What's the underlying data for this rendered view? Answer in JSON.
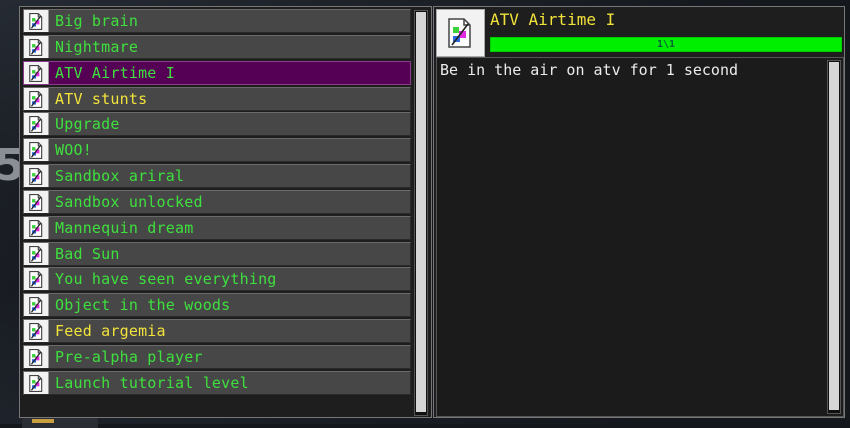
{
  "achievements": [
    {
      "label": "Big brain",
      "color": "#3ee03e",
      "selected": false
    },
    {
      "label": "Nightmare",
      "color": "#3ee03e",
      "selected": false
    },
    {
      "label": "ATV Airtime I",
      "color": "#3ee03e",
      "selected": true
    },
    {
      "label": "ATV stunts",
      "color": "#f2e33a",
      "selected": false
    },
    {
      "label": "Upgrade",
      "color": "#3ee03e",
      "selected": false
    },
    {
      "label": "WOO!",
      "color": "#3ee03e",
      "selected": false
    },
    {
      "label": "Sandbox ariral",
      "color": "#3ee03e",
      "selected": false
    },
    {
      "label": "Sandbox unlocked",
      "color": "#3ee03e",
      "selected": false
    },
    {
      "label": "Mannequin dream",
      "color": "#3ee03e",
      "selected": false
    },
    {
      "label": "Bad Sun",
      "color": "#3ee03e",
      "selected": false
    },
    {
      "label": "You have seen everything",
      "color": "#3ee03e",
      "selected": false
    },
    {
      "label": "Object in the woods",
      "color": "#3ee03e",
      "selected": false
    },
    {
      "label": "Feed argemia",
      "color": "#f2e33a",
      "selected": false
    },
    {
      "label": "Pre-alpha player",
      "color": "#3ee03e",
      "selected": false
    },
    {
      "label": "Launch tutorial level",
      "color": "#3ee03e",
      "selected": false
    }
  ],
  "detail": {
    "title": "ATV Airtime I",
    "progress_text": "1\\1",
    "progress_fraction": 1.0,
    "description": "Be in the air on atv for 1 second",
    "icon": "broken-image-icon"
  },
  "background": {
    "edge_char": "5"
  }
}
